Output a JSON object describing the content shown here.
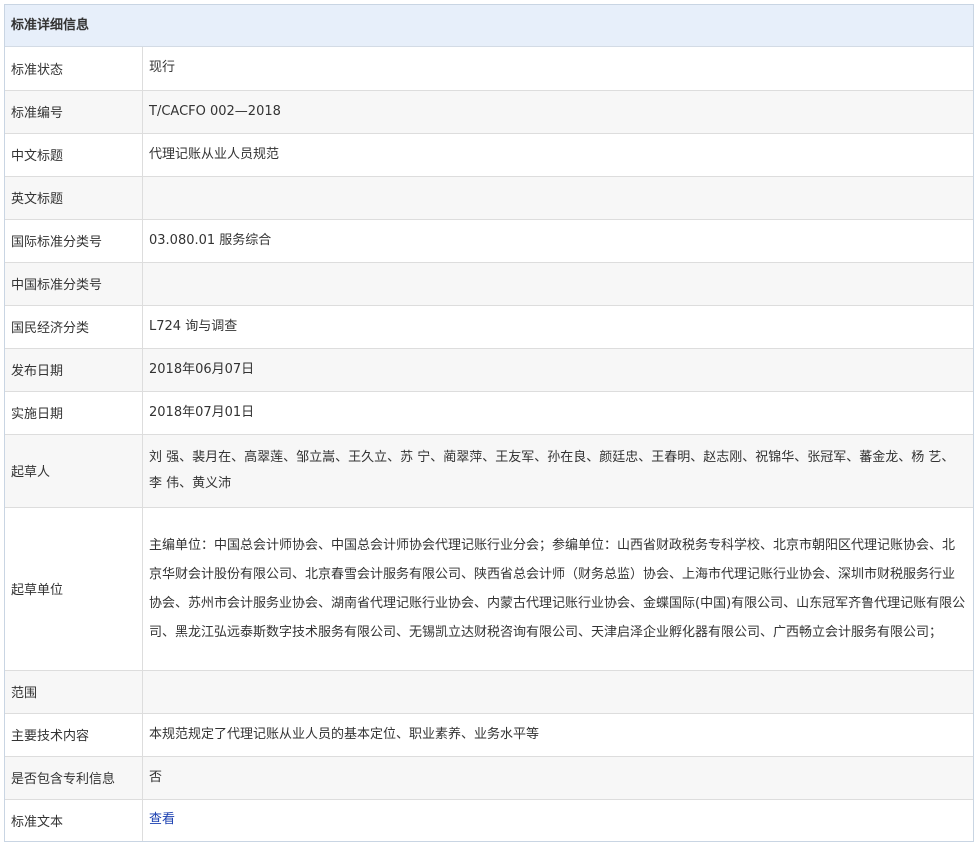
{
  "panel": {
    "title": "标准详细信息"
  },
  "rows": [
    {
      "label": "标准状态",
      "value": "现行"
    },
    {
      "label": "标准编号",
      "value": "T/CACFO 002—2018"
    },
    {
      "label": "中文标题",
      "value": "代理记账从业人员规范"
    },
    {
      "label": "英文标题",
      "value": ""
    },
    {
      "label": "国际标准分类号",
      "value": "03.080.01 服务综合"
    },
    {
      "label": "中国标准分类号",
      "value": ""
    },
    {
      "label": "国民经济分类",
      "value": "L724 询与调查"
    },
    {
      "label": "发布日期",
      "value": "2018年06月07日"
    },
    {
      "label": "实施日期",
      "value": "2018年07月01日"
    },
    {
      "label": "起草人",
      "value": "刘 强、裴月在、高翠莲、邹立嵩、王久立、苏 宁、蔺翠萍、王友军、孙在良、颜廷忠、王春明、赵志刚、祝锦华、张冠军、蕃金龙、杨 艺、李 伟、黄义沛"
    },
    {
      "label": "起草单位",
      "value": "主编单位：中国总会计师协会、中国总会计师协会代理记账行业分会；参编单位：山西省财政税务专科学校、北京市朝阳区代理记账协会、北京华财会计股份有限公司、北京春雪会计服务有限公司、陕西省总会计师（财务总监）协会、上海市代理记账行业协会、深圳市财税服务行业协会、苏州市会计服务业协会、湖南省代理记账行业协会、内蒙古代理记账行业协会、金蝶国际(中国)有限公司、山东冠军齐鲁代理记账有限公司、黑龙江弘远泰斯数字技术服务有限公司、无锡凯立达财税咨询有限公司、天津启泽企业孵化器有限公司、广西畅立会计服务有限公司；"
    },
    {
      "label": "范围",
      "value": ""
    },
    {
      "label": "主要技术内容",
      "value": "本规范规定了代理记账从业人员的基本定位、职业素养、业务水平等"
    },
    {
      "label": "是否包含专利信息",
      "value": "否"
    },
    {
      "label": "标准文本",
      "value": "查看"
    }
  ]
}
